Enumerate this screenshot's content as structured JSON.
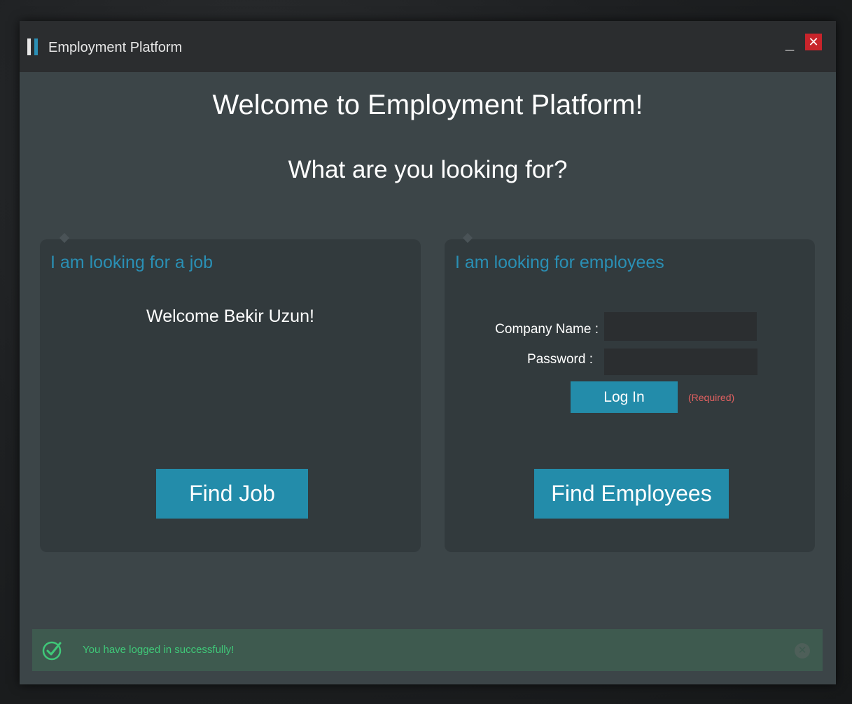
{
  "window": {
    "title": "Employment Platform",
    "minimize_label": "_",
    "close_label": "✕"
  },
  "main": {
    "heading": "Welcome to Employment Platform!",
    "subheading": "What are you looking for?"
  },
  "job_panel": {
    "title": "I am looking for a job",
    "welcome": "Welcome Bekir Uzun!",
    "find_button": "Find Job"
  },
  "employer_panel": {
    "title": "I am looking for employees",
    "company_label": "Company Name :",
    "company_value": "",
    "password_label": "Password :",
    "password_value": "",
    "login_button": "Log In",
    "required_text": "(Required)",
    "find_button": "Find Employees"
  },
  "notification": {
    "message": "You have logged in successfully!",
    "icon": "check-circle-icon",
    "close_icon": "close-circle-icon",
    "close_label": "✕"
  },
  "colors": {
    "accent": "#238caa",
    "title_accent": "#2a8fb4",
    "success": "#3fc878",
    "error": "#e06060",
    "close": "#c8242b"
  }
}
